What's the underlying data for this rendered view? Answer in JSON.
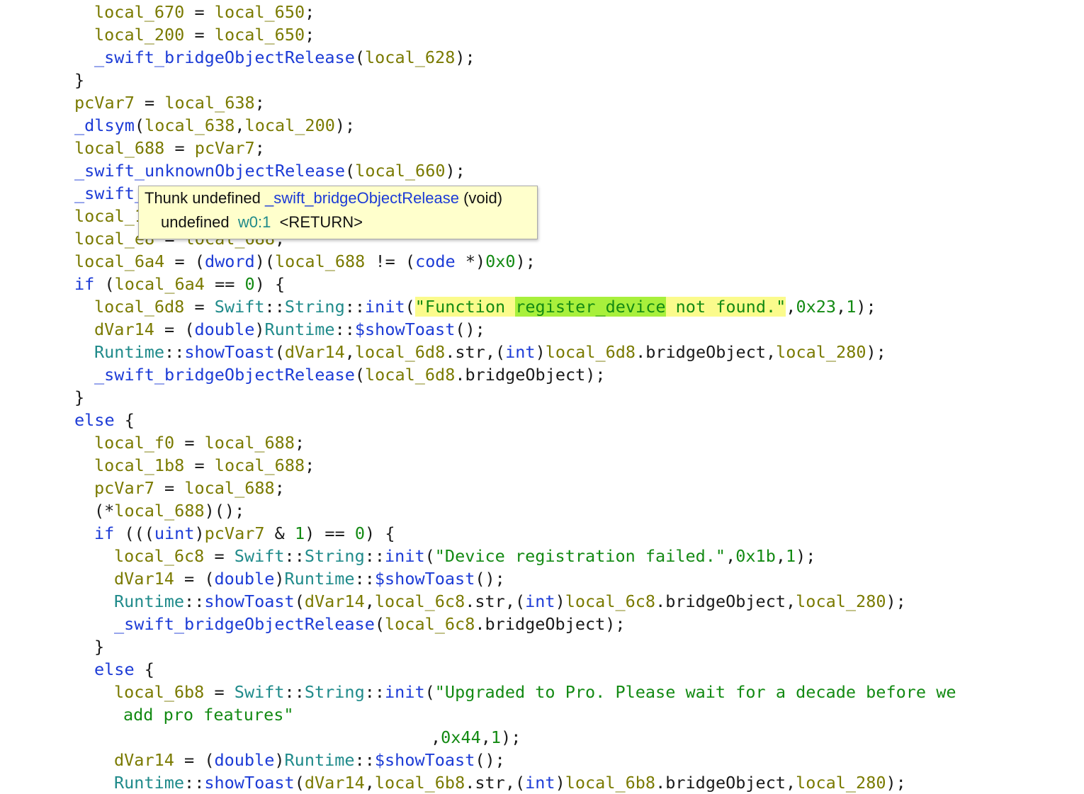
{
  "lines": [
    [
      [
        "var",
        "local_670"
      ],
      [
        "op",
        " = "
      ],
      [
        "var",
        "local_650"
      ],
      [
        "op",
        ";"
      ]
    ],
    [
      [
        "var",
        "local_200"
      ],
      [
        "op",
        " = "
      ],
      [
        "var",
        "local_650"
      ],
      [
        "op",
        ";"
      ]
    ],
    [
      [
        "fn",
        "_swift_bridgeObjectRelease"
      ],
      [
        "op",
        "("
      ],
      [
        "var",
        "local_628"
      ],
      [
        "op",
        ");"
      ]
    ],
    [
      [
        "op",
        "}"
      ]
    ],
    [
      [
        "var",
        "pcVar7"
      ],
      [
        "op",
        " = "
      ],
      [
        "var",
        "local_638"
      ],
      [
        "op",
        ";"
      ]
    ],
    [
      [
        "fn",
        "_dlsym"
      ],
      [
        "op",
        "("
      ],
      [
        "var",
        "local_638"
      ],
      [
        "op",
        ","
      ],
      [
        "var",
        "local_200"
      ],
      [
        "op",
        ");"
      ]
    ],
    [
      [
        "var",
        "local_688"
      ],
      [
        "op",
        " = "
      ],
      [
        "var",
        "pcVar7"
      ],
      [
        "op",
        ";"
      ]
    ],
    [
      [
        "fn",
        "_swift_unknownObjectRelease"
      ],
      [
        "op",
        "("
      ],
      [
        "var",
        "local_660"
      ],
      [
        "op",
        ");"
      ]
    ],
    [
      [
        "fn",
        "_swift_"
      ]
    ],
    [
      [
        "var",
        "local_1"
      ]
    ],
    [
      [
        "var",
        "local_e8"
      ],
      [
        "op",
        " = "
      ],
      [
        "var",
        "local_688"
      ],
      [
        "op",
        ";"
      ]
    ],
    [
      [
        "var",
        "local_6a4"
      ],
      [
        "op",
        " = ("
      ],
      [
        "kw",
        "dword"
      ],
      [
        "op",
        ")("
      ],
      [
        "var",
        "local_688"
      ],
      [
        "op",
        " != ("
      ],
      [
        "kw",
        "code"
      ],
      [
        "op",
        " *)"
      ],
      [
        "num",
        "0x0"
      ],
      [
        "op",
        ");"
      ]
    ],
    [
      [
        "kw",
        "if"
      ],
      [
        "op",
        " ("
      ],
      [
        "var",
        "local_6a4"
      ],
      [
        "op",
        " == "
      ],
      [
        "num",
        "0"
      ],
      [
        "op",
        ") {"
      ]
    ],
    [
      [
        "var",
        "local_6d8"
      ],
      [
        "op",
        " = "
      ],
      [
        "ns",
        "Swift"
      ],
      [
        "op",
        "::"
      ],
      [
        "ns",
        "String"
      ],
      [
        "op",
        "::"
      ],
      [
        "fn",
        "init"
      ],
      [
        "op",
        "("
      ],
      [
        "strhl",
        "\"Function "
      ],
      [
        "strhl2",
        "register_device"
      ],
      [
        "strhl",
        " not found.\""
      ],
      [
        "op",
        ","
      ],
      [
        "num",
        "0x23"
      ],
      [
        "op",
        ","
      ],
      [
        "num",
        "1"
      ],
      [
        "op",
        ");"
      ]
    ],
    [
      [
        "var",
        "dVar14"
      ],
      [
        "op",
        " = ("
      ],
      [
        "kw",
        "double"
      ],
      [
        "op",
        ")"
      ],
      [
        "ns",
        "Runtime"
      ],
      [
        "op",
        "::"
      ],
      [
        "fn",
        "$showToast"
      ],
      [
        "op",
        "();"
      ]
    ],
    [
      [
        "ns",
        "Runtime"
      ],
      [
        "op",
        "::"
      ],
      [
        "fn",
        "showToast"
      ],
      [
        "op",
        "("
      ],
      [
        "var",
        "dVar14"
      ],
      [
        "op",
        ","
      ],
      [
        "var",
        "local_6d8"
      ],
      [
        "op",
        ".str,("
      ],
      [
        "kw",
        "int"
      ],
      [
        "op",
        ")"
      ],
      [
        "var",
        "local_6d8"
      ],
      [
        "op",
        ".bridgeObject,"
      ],
      [
        "var",
        "local_280"
      ],
      [
        "op",
        ");"
      ]
    ],
    [
      [
        "fn",
        "_swift_bridgeObjectRelease"
      ],
      [
        "op",
        "("
      ],
      [
        "var",
        "local_6d8"
      ],
      [
        "op",
        ".bridgeObject);"
      ]
    ],
    [
      [
        "op",
        "}"
      ]
    ],
    [
      [
        "kw",
        "else"
      ],
      [
        "op",
        " {"
      ]
    ],
    [
      [
        "var",
        "local_f0"
      ],
      [
        "op",
        " = "
      ],
      [
        "var",
        "local_688"
      ],
      [
        "op",
        ";"
      ]
    ],
    [
      [
        "var",
        "local_1b8"
      ],
      [
        "op",
        " = "
      ],
      [
        "var",
        "local_688"
      ],
      [
        "op",
        ";"
      ]
    ],
    [
      [
        "var",
        "pcVar7"
      ],
      [
        "op",
        " = "
      ],
      [
        "var",
        "local_688"
      ],
      [
        "op",
        ";"
      ]
    ],
    [
      [
        "op",
        "(*"
      ],
      [
        "var",
        "local_688"
      ],
      [
        "op",
        ")();"
      ]
    ],
    [
      [
        "kw",
        "if"
      ],
      [
        "op",
        " ((("
      ],
      [
        "kw",
        "uint"
      ],
      [
        "op",
        ")"
      ],
      [
        "var",
        "pcVar7"
      ],
      [
        "op",
        " & "
      ],
      [
        "num",
        "1"
      ],
      [
        "op",
        ") == "
      ],
      [
        "num",
        "0"
      ],
      [
        "op",
        ") {"
      ]
    ],
    [
      [
        "var",
        "local_6c8"
      ],
      [
        "op",
        " = "
      ],
      [
        "ns",
        "Swift"
      ],
      [
        "op",
        "::"
      ],
      [
        "ns",
        "String"
      ],
      [
        "op",
        "::"
      ],
      [
        "fn",
        "init"
      ],
      [
        "op",
        "("
      ],
      [
        "str",
        "\"Device registration failed.\""
      ],
      [
        "op",
        ","
      ],
      [
        "num",
        "0x1b"
      ],
      [
        "op",
        ","
      ],
      [
        "num",
        "1"
      ],
      [
        "op",
        ");"
      ]
    ],
    [
      [
        "var",
        "dVar14"
      ],
      [
        "op",
        " = ("
      ],
      [
        "kw",
        "double"
      ],
      [
        "op",
        ")"
      ],
      [
        "ns",
        "Runtime"
      ],
      [
        "op",
        "::"
      ],
      [
        "fn",
        "$showToast"
      ],
      [
        "op",
        "();"
      ]
    ],
    [
      [
        "ns",
        "Runtime"
      ],
      [
        "op",
        "::"
      ],
      [
        "fn",
        "showToast"
      ],
      [
        "op",
        "("
      ],
      [
        "var",
        "dVar14"
      ],
      [
        "op",
        ","
      ],
      [
        "var",
        "local_6c8"
      ],
      [
        "op",
        ".str,("
      ],
      [
        "kw",
        "int"
      ],
      [
        "op",
        ")"
      ],
      [
        "var",
        "local_6c8"
      ],
      [
        "op",
        ".bridgeObject,"
      ],
      [
        "var",
        "local_280"
      ],
      [
        "op",
        ");"
      ]
    ],
    [
      [
        "fn",
        "_swift_bridgeObjectRelease"
      ],
      [
        "op",
        "("
      ],
      [
        "var",
        "local_6c8"
      ],
      [
        "op",
        ".bridgeObject);"
      ]
    ],
    [
      [
        "op",
        "}"
      ]
    ],
    [
      [
        "kw",
        "else"
      ],
      [
        "op",
        " {"
      ]
    ],
    [
      [
        "var",
        "local_6b8"
      ],
      [
        "op",
        " = "
      ],
      [
        "ns",
        "Swift"
      ],
      [
        "op",
        "::"
      ],
      [
        "ns",
        "String"
      ],
      [
        "op",
        "::"
      ],
      [
        "fn",
        "init"
      ],
      [
        "op",
        "("
      ],
      [
        "str",
        "\"Upgraded to Pro. Please wait for a decade before we"
      ]
    ],
    [
      [
        "str",
        "add pro features\""
      ]
    ],
    [
      [
        "op",
        ","
      ],
      [
        "num",
        "0x44"
      ],
      [
        "op",
        ","
      ],
      [
        "num",
        "1"
      ],
      [
        "op",
        ");"
      ]
    ],
    [
      [
        "var",
        "dVar14"
      ],
      [
        "op",
        " = ("
      ],
      [
        "kw",
        "double"
      ],
      [
        "op",
        ")"
      ],
      [
        "ns",
        "Runtime"
      ],
      [
        "op",
        "::"
      ],
      [
        "fn",
        "$showToast"
      ],
      [
        "op",
        "();"
      ]
    ],
    [
      [
        "ns",
        "Runtime"
      ],
      [
        "op",
        "::"
      ],
      [
        "fn",
        "showToast"
      ],
      [
        "op",
        "("
      ],
      [
        "var",
        "dVar14"
      ],
      [
        "op",
        ","
      ],
      [
        "var",
        "local_6b8"
      ],
      [
        "op",
        ".str,("
      ],
      [
        "kw",
        "int"
      ],
      [
        "op",
        ")"
      ],
      [
        "var",
        "local_6b8"
      ],
      [
        "op",
        ".bridgeObject,"
      ],
      [
        "var",
        "local_280"
      ],
      [
        "op",
        ");"
      ]
    ]
  ],
  "tooltip": {
    "prefix": "Thunk undefined ",
    "function_name": "_swift_bridgeObjectRelease",
    "suffix": " (void)",
    "return_type": "undefined  ",
    "register": "w0:1",
    "return_label": "  <RETURN>"
  }
}
